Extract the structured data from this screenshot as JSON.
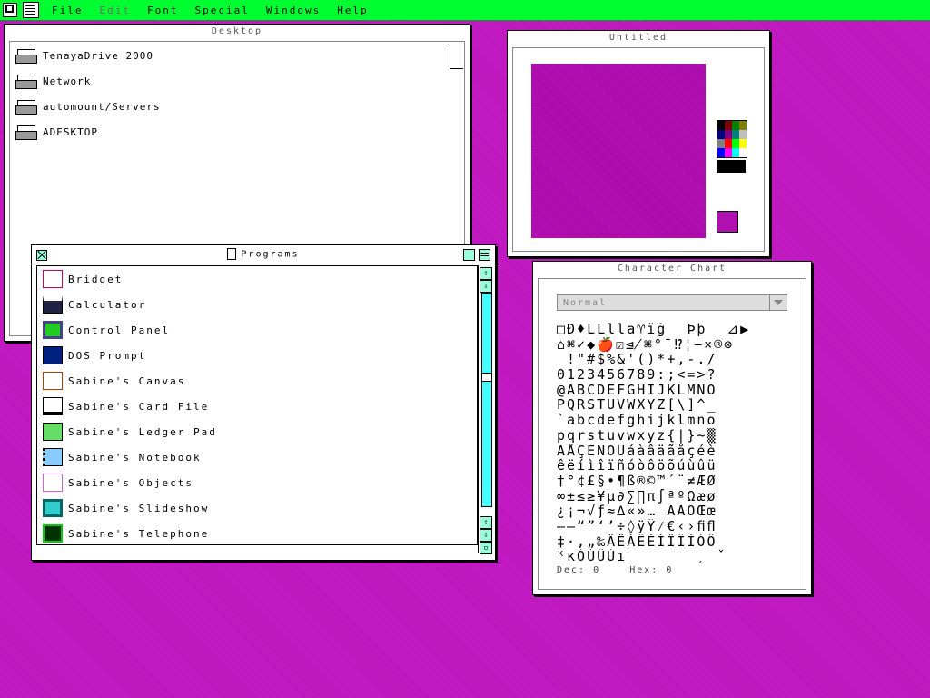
{
  "menubar": {
    "items": [
      {
        "label": "File",
        "enabled": true
      },
      {
        "label": "Edit",
        "enabled": false
      },
      {
        "label": "Font",
        "enabled": true
      },
      {
        "label": "Special",
        "enabled": true
      },
      {
        "label": "Windows",
        "enabled": true
      },
      {
        "label": "Help",
        "enabled": true
      }
    ],
    "color": "#00ff30"
  },
  "desktop": {
    "title": "Desktop",
    "drives": [
      {
        "label": "TenayaDrive 2000"
      },
      {
        "label": "Network"
      },
      {
        "label": "automount/Servers"
      },
      {
        "label": "ADESKTOP"
      }
    ]
  },
  "untitled": {
    "title": "Untitled",
    "palette": [
      "#000000",
      "#800000",
      "#008000",
      "#808000",
      "#000080",
      "#800080",
      "#008080",
      "#c0c0c0",
      "#808080",
      "#ff0000",
      "#00ff00",
      "#ffff00",
      "#0000ff",
      "#ff00ff",
      "#00ffff",
      "#ffffff"
    ],
    "current_color": "#b010b0"
  },
  "charchart": {
    "title": "Character Chart",
    "font_style": "Normal",
    "rows": [
      "□Ð♦LLlla♈ï̈ġ  Þþ  ⊿▶",
      "⌂⌘✓◆🍎☑⋬⌘°¯⁉¦−×®⊗",
      " !\"#$%&'()*+,-./",
      "0123456789:;<=>?",
      "@ABCDEFGHIJKLMNO",
      "PQRSTUVWXYZ[\\]^_",
      "`abcdefghijklmno",
      "pqrstuvwxyz{|}~▒",
      "ÄÅÇÉÑÖÜáàâäãåçéè",
      "êëíìîïñóòôöõúùûü",
      "†°¢£§•¶ß®©™´¨≠ÆØ",
      "∞±≤≥¥µ∂∑∏π∫ªºΩæø",
      "¿¡¬√ƒ≈∆«»… ÀÃÕŒœ",
      "–—“”‘’÷◊ÿŸ⁄€‹›ﬁﬂ",
      "‡·‚„‰ÂÊÁËÈÍÎÏÌÓÔ",
      "ᴷĸÒÚÛÙı       ˛ ˇ"
    ],
    "dec_label": "Dec:",
    "dec_value": "0",
    "hex_label": "Hex:",
    "hex_value": "0"
  },
  "programs": {
    "title": "Programs",
    "items": [
      {
        "label": "Bridget",
        "icon": "bridget-icon"
      },
      {
        "label": "Calculator",
        "icon": "calculator-icon"
      },
      {
        "label": "Control Panel",
        "icon": "control-panel-icon"
      },
      {
        "label": "DOS Prompt",
        "icon": "dos-prompt-icon"
      },
      {
        "label": "Sabine's Canvas",
        "icon": "canvas-easel-icon"
      },
      {
        "label": "Sabine's Card File",
        "icon": "card-file-icon"
      },
      {
        "label": "Sabine's Ledger Pad",
        "icon": "ledger-pad-icon"
      },
      {
        "label": "Sabine's Notebook",
        "icon": "notebook-icon"
      },
      {
        "label": "Sabine's Objects",
        "icon": "objects-icon"
      },
      {
        "label": "Sabine's Slideshow",
        "icon": "slideshow-icon"
      },
      {
        "label": "Sabine's Telephone",
        "icon": "telephone-icon"
      }
    ]
  }
}
